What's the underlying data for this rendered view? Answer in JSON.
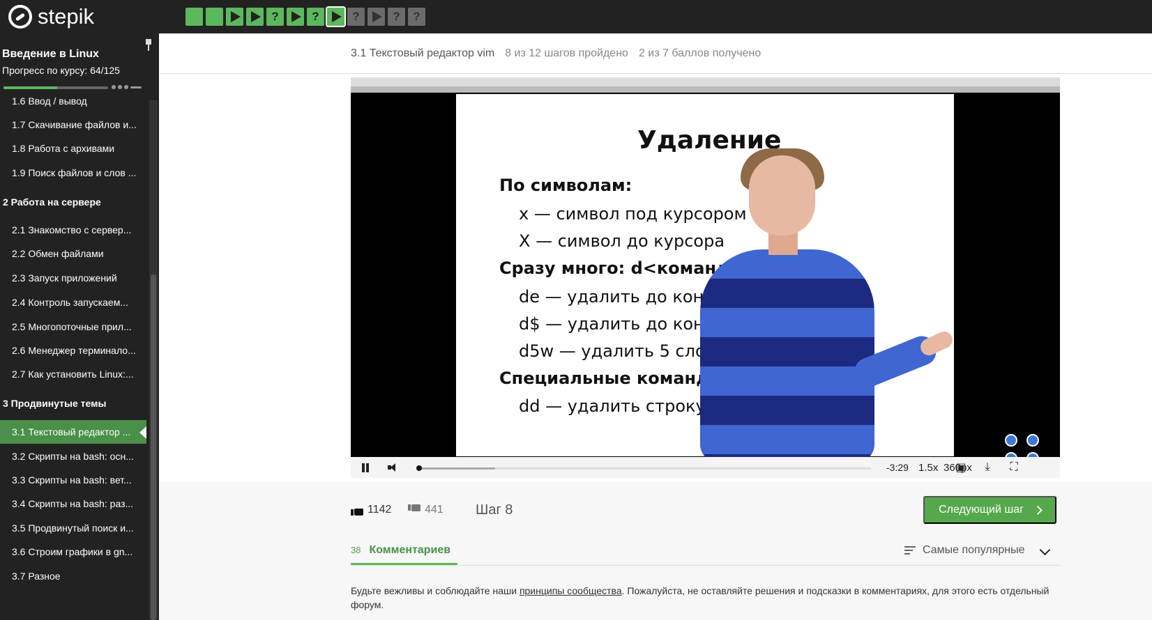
{
  "brand": "stepik",
  "course": {
    "title": "Введение в Linux",
    "progress_label": "Прогресс по курсу:  64/125",
    "progress_fraction": 0.512
  },
  "lessons": [
    {
      "label": "1.6  Ввод / вывод",
      "type": "lesson"
    },
    {
      "label": "1.7  Скачивание файлов и...",
      "type": "lesson"
    },
    {
      "label": "1.8  Работа с архивами",
      "type": "lesson"
    },
    {
      "label": "1.9  Поиск файлов и слов ...",
      "type": "lesson"
    },
    {
      "label": "2  Работа на сервере",
      "type": "section"
    },
    {
      "label": "2.1  Знакомство с сервер...",
      "type": "lesson"
    },
    {
      "label": "2.2  Обмен файлами",
      "type": "lesson"
    },
    {
      "label": "2.3  Запуск приложений",
      "type": "lesson"
    },
    {
      "label": "2.4  Контроль запускаем...",
      "type": "lesson"
    },
    {
      "label": "2.5  Многопоточные прил...",
      "type": "lesson"
    },
    {
      "label": "2.6  Менеджер терминало...",
      "type": "lesson"
    },
    {
      "label": "2.7  Как установить Linux:...",
      "type": "lesson"
    },
    {
      "label": "3  Продвинутые темы",
      "type": "section"
    },
    {
      "label": "3.1  Текстовый редактор ...",
      "type": "active"
    },
    {
      "label": "3.2  Скрипты на bash: осн...",
      "type": "lesson"
    },
    {
      "label": "3.3  Скрипты на bash: вет...",
      "type": "lesson"
    },
    {
      "label": "3.4  Скрипты на bash: раз...",
      "type": "lesson"
    },
    {
      "label": "3.5  Продвинутый поиск и...",
      "type": "lesson"
    },
    {
      "label": "3.6  Строим графики в gn...",
      "type": "lesson"
    },
    {
      "label": "3.7  Разное",
      "type": "lesson"
    }
  ],
  "step_nav": [
    {
      "status": "done",
      "icon": "blank"
    },
    {
      "status": "done",
      "icon": "blank"
    },
    {
      "status": "done",
      "icon": "play"
    },
    {
      "status": "done",
      "icon": "play"
    },
    {
      "status": "done",
      "icon": "question"
    },
    {
      "status": "done",
      "icon": "play"
    },
    {
      "status": "done",
      "icon": "question"
    },
    {
      "status": "current",
      "icon": "play"
    },
    {
      "status": "todo",
      "icon": "question"
    },
    {
      "status": "todo",
      "icon": "play"
    },
    {
      "status": "todo",
      "icon": "question"
    },
    {
      "status": "todo",
      "icon": "question"
    }
  ],
  "lesson_header": {
    "title": "3.1 Текстовый редактор vim",
    "steps": "8 из 12 шагов пройдено",
    "points": "2 из 7 баллов  получено"
  },
  "video": {
    "slide_title": "Удаление",
    "lines": [
      "По символам:",
      "x — символ под курсором",
      "X — символ до курсора",
      "Сразу много: d<команда>",
      "de — удалить до конца этого слова",
      "d$ — удалить до конца строки",
      "d5w — удалить 5 слов",
      "Специальные команды:",
      "dd — удалить строку (например, d10d)"
    ],
    "time": "-3:29",
    "rate": "1.5x",
    "quality": "360px",
    "played_fraction": 0.17
  },
  "actions": {
    "likes": "1142",
    "dislikes": "441",
    "step": "Шаг 8",
    "next_button": "Следующий шаг"
  },
  "comments": {
    "count": "38",
    "label": "Комментариев",
    "sort": "Самые популярные",
    "rules_before": "Будьте вежливы и соблюдайте наши ",
    "rules_link": "принципы сообщества",
    "rules_after": ". Пожалуйста, не оставляйте решения и подсказки в комментариях, для этого есть отдельный форум."
  },
  "colors": {
    "accent": "#5cb85c",
    "sidebar": "#222222",
    "active_lesson": "#4a8f4a"
  }
}
